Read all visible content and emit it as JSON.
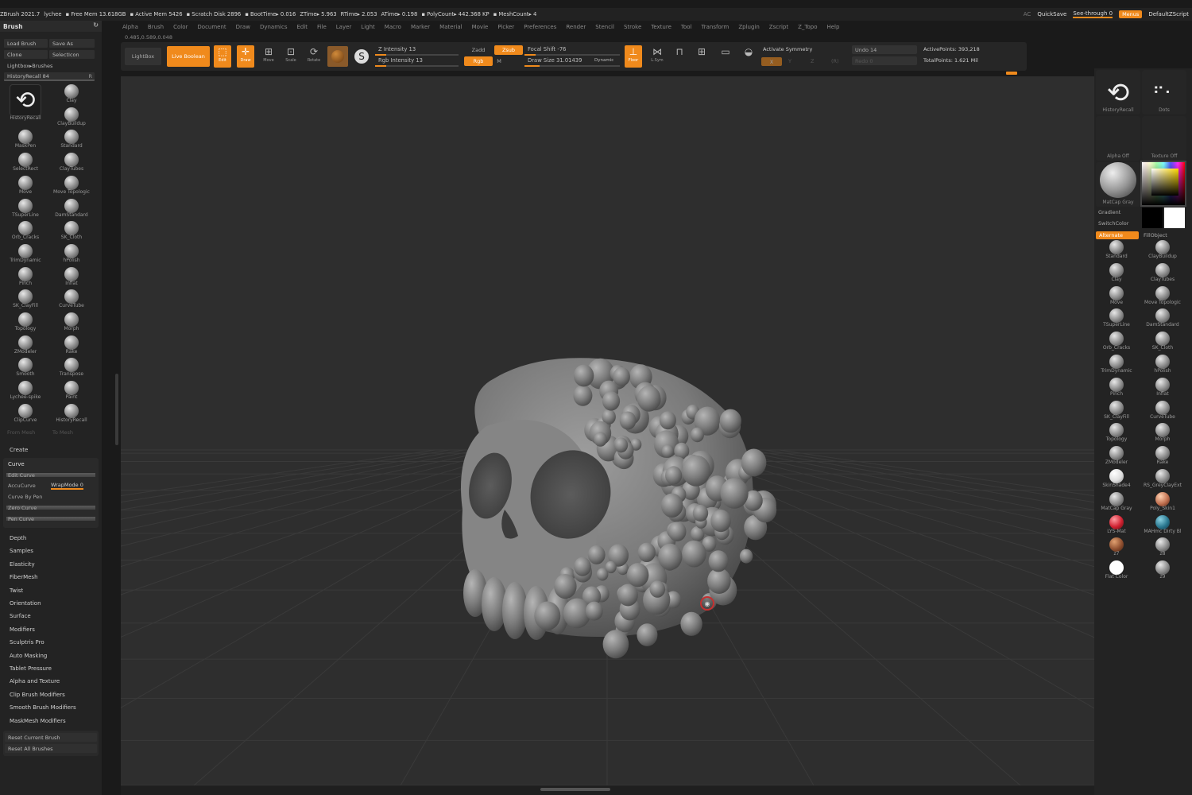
{
  "statusbar": {
    "app": "ZBrush 2021.7",
    "project": "lychee",
    "free_mem": "▪ Free Mem 13.618GB",
    "active_mem": "▪ Active Mem 5426",
    "scratch": "▪ Scratch Disk 2896",
    "boot": "▪ BootTime▸ 0.016",
    "ztime": "ZTime▸ 5.963",
    "rtime": "RTime▸ 2.053",
    "atime": "ATime▸ 0.198",
    "poly": "▪ PolyCount▸ 442.368 KP",
    "mesh": "▪ MeshCount▸ 4",
    "ac": "AC",
    "quicksave": "QuickSave",
    "seethrough": "See-through 0",
    "menus": "Menus",
    "default_script": "DefaultZScript"
  },
  "menubar": [
    "Alpha",
    "Brush",
    "Color",
    "Document",
    "Draw",
    "Dynamics",
    "Edit",
    "File",
    "Layer",
    "Light",
    "Macro",
    "Marker",
    "Material",
    "Movie",
    "Picker",
    "Preferences",
    "Render",
    "Stencil",
    "Stroke",
    "Texture",
    "Tool",
    "Transform",
    "Zplugin",
    "Zscript",
    "Z_Topo",
    "Help"
  ],
  "coords": "0.485,0.589,0.048",
  "toolbar": {
    "lightbox": "LightBox",
    "live_boolean": "Live Boolean",
    "edit": "Edit",
    "draw": "Draw",
    "move": "Move",
    "scale": "Scale",
    "rotate": "Rotate",
    "z_intensity": "Z Intensity 13",
    "z_intensity_value": 0.13,
    "rgb_intensity": "Rgb Intensity 13",
    "rgb_intensity_value": 0.13,
    "zadd": "Zadd",
    "zsub": "Zsub",
    "rgb": "Rgb",
    "m": "M",
    "focal_shift": "Focal Shift -76",
    "draw_size": "Draw Size 31.01439",
    "dynamic": "Dynamic",
    "floor": "Floor",
    "lsym": "L.Sym",
    "activate_symmetry": "Activate Symmetry",
    "x": "X",
    "y": "Y",
    "z": "Z",
    "r": "(R)",
    "undo": "Undo 14",
    "redo": "Redo 0",
    "active_points": "ActivePoints: 393,218",
    "total_points": "TotalPoints: 1.621 Mil"
  },
  "leftpanel": {
    "title": "Brush",
    "load_brush": "Load Brush",
    "save_as": "Save As",
    "clone": "Clone",
    "select_icon": "SelectIcon",
    "lightbox_brushes": "Lightbox▸Brushes",
    "history_recall": "HistoryRecall",
    "history_value": "84",
    "history_r": "R",
    "brushes": [
      {
        "l": "HistoryRecall",
        "r": "Clay"
      },
      {
        "l": "",
        "r": "ClayBuildup"
      },
      {
        "l": "MaskPen",
        "r": "Standard"
      },
      {
        "l": "SelectRect",
        "r": "ClayTubes"
      },
      {
        "l": "Move",
        "r": "Move Topologic"
      },
      {
        "l": "TSuperLine",
        "r": "DamStandard"
      },
      {
        "l": "Orb_Cracks",
        "r": "SK_Cloth"
      },
      {
        "l": "TrimDynamic",
        "r": "hPolish"
      },
      {
        "l": "Pinch",
        "r": "Inflat"
      },
      {
        "l": "SK_ClayFill",
        "r": "CurveTube"
      },
      {
        "l": "Topology",
        "r": "Morph"
      },
      {
        "l": "ZModeler",
        "r": "Rake"
      },
      {
        "l": "Smooth",
        "r": "Transpose"
      },
      {
        "l": "Lychee-spike",
        "r": "Paint"
      },
      {
        "l": "ClipCurve",
        "r": "HistoryRecall"
      }
    ],
    "from_mesh": "From Mesh",
    "to_mesh": "To Mesh",
    "create": "Create",
    "curve": "Curve",
    "edit_curve": "Edit Curve",
    "accucurve": "AccuCurve",
    "wrapmode": "WrapMode 0",
    "curve_by_pen": "Curve By Pen",
    "zero_curve": "Zero Curve",
    "pen_curve": "Pen Curve",
    "sections": [
      "Depth",
      "Samples",
      "Elasticity",
      "FiberMesh",
      "Twist",
      "Orientation",
      "Surface",
      "Modifiers",
      "Sculptris Pro",
      "Auto Masking",
      "Tablet Pressure",
      "Alpha and Texture",
      "Clip Brush Modifiers",
      "Smooth Brush Modifiers",
      "MaskMesh Modifiers"
    ],
    "reset_current": "Reset Current Brush",
    "reset_all": "Reset All Brushes"
  },
  "rightpanel": {
    "history_recall": "HistoryRecall",
    "dots": "Dots",
    "alpha_off": "Alpha Off",
    "texture_off": "Texture Off",
    "matcap_gray": "MatCap Gray",
    "gradient": "Gradient",
    "switch_color": "SwitchColor",
    "alternate": "Alternate",
    "fill_object": "FillObject",
    "brushes": [
      {
        "l": "Standard",
        "r": "ClayBuildup"
      },
      {
        "l": "Clay",
        "r": "ClayTubes"
      },
      {
        "l": "Move",
        "r": "Move Topologic"
      },
      {
        "l": "TSuperLine",
        "r": "DamStandard"
      },
      {
        "l": "Orb_Cracks",
        "r": "SK_Cloth"
      },
      {
        "l": "TrimDynamic",
        "r": "hPolish"
      },
      {
        "l": "Pinch",
        "r": "Inflat"
      },
      {
        "l": "SK_ClayFill",
        "r": "CurveTube"
      },
      {
        "l": "Topology",
        "r": "Morph"
      },
      {
        "l": "ZModeler",
        "r": "Rake"
      },
      {
        "l": "SkinShade4",
        "r": "RS_GreyClayExt"
      },
      {
        "l": "MatCap Gray",
        "r": "Poly_Skin1"
      },
      {
        "l": "LYS-Mat",
        "r": "MAHmc Dirty Bl"
      },
      {
        "l": "z7",
        "r": "z8"
      },
      {
        "l": "Flat Color",
        "r": "z9"
      }
    ]
  }
}
